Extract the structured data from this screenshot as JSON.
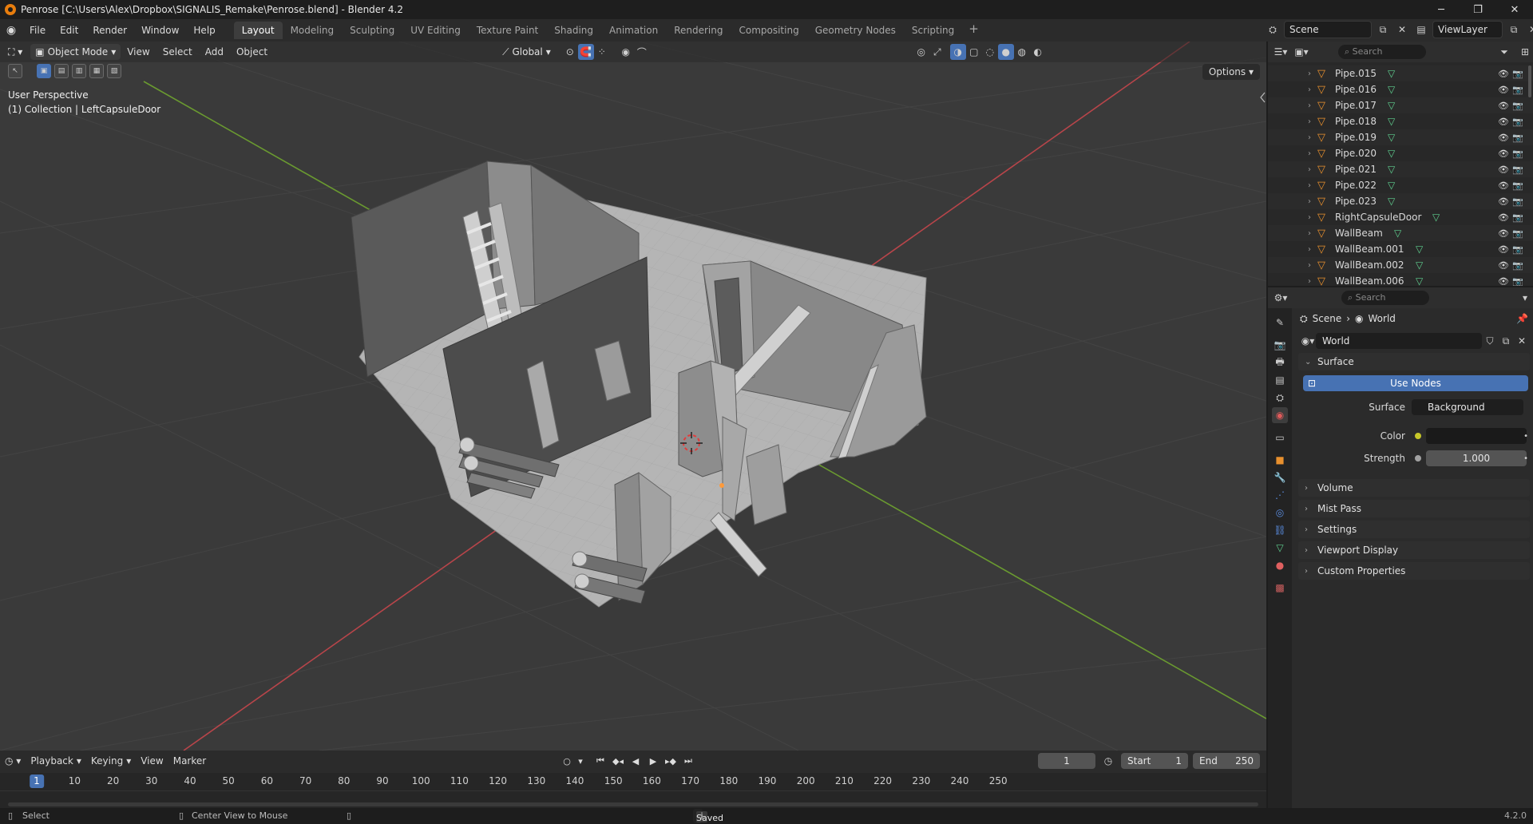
{
  "window": {
    "title": "Penrose [C:\\Users\\Alex\\Dropbox\\SIGNALIS_Remake\\Penrose.blend] - Blender 4.2",
    "controls": [
      "─",
      "❐",
      "✕"
    ]
  },
  "menubar": {
    "menus": [
      "File",
      "Edit",
      "Render",
      "Window",
      "Help"
    ],
    "workspaces": [
      "Layout",
      "Modeling",
      "Sculpting",
      "UV Editing",
      "Texture Paint",
      "Shading",
      "Animation",
      "Rendering",
      "Compositing",
      "Geometry Nodes",
      "Scripting"
    ],
    "active_workspace": "Layout",
    "scene": "Scene",
    "view_layer": "ViewLayer"
  },
  "viewport": {
    "mode": "Object Mode",
    "menus": [
      "View",
      "Select",
      "Add",
      "Object"
    ],
    "transform_orientation": "Global",
    "options_label": "Options",
    "perspective_label": "User Perspective",
    "collection_label": "(1) Collection | LeftCapsuleDoor"
  },
  "outliner": {
    "search_placeholder": "Search",
    "items": [
      {
        "name": "Pipe.015"
      },
      {
        "name": "Pipe.016"
      },
      {
        "name": "Pipe.017"
      },
      {
        "name": "Pipe.018"
      },
      {
        "name": "Pipe.019"
      },
      {
        "name": "Pipe.020"
      },
      {
        "name": "Pipe.021"
      },
      {
        "name": "Pipe.022"
      },
      {
        "name": "Pipe.023"
      },
      {
        "name": "RightCapsuleDoor"
      },
      {
        "name": "WallBeam"
      },
      {
        "name": "WallBeam.001"
      },
      {
        "name": "WallBeam.002"
      },
      {
        "name": "WallBeam.006"
      }
    ]
  },
  "properties": {
    "search_placeholder": "Search",
    "breadcrumb": [
      "Scene",
      "World"
    ],
    "world_name": "World",
    "surface_panel": "Surface",
    "use_nodes_label": "Use Nodes",
    "surface_label": "Surface",
    "surface_value": "Background",
    "color_label": "Color",
    "strength_label": "Strength",
    "strength_value": "1.000",
    "collapsed_panels": [
      "Volume",
      "Mist Pass",
      "Settings",
      "Viewport Display",
      "Custom Properties"
    ]
  },
  "timeline": {
    "menus": [
      "Playback",
      "Keying",
      "View",
      "Marker"
    ],
    "current_frame": "1",
    "start_label": "Start",
    "start_value": "1",
    "end_label": "End",
    "end_value": "250",
    "ticks": [
      "10",
      "20",
      "30",
      "40",
      "50",
      "60",
      "70",
      "80",
      "90",
      "100",
      "110",
      "120",
      "130",
      "140",
      "150",
      "160",
      "170",
      "180",
      "190",
      "200",
      "210",
      "220",
      "230",
      "240",
      "250"
    ]
  },
  "statusbar": {
    "select_label": "Select",
    "center_view_label": "Center View to Mouse",
    "message": "Saved \"Penrose.blend\"",
    "version": "4.2.0"
  },
  "colors": {
    "accent_blue": "#4772b3",
    "x_axis": "#b8454a",
    "y_axis": "#6a9a30",
    "mesh_orange": "#e8902e",
    "data_green": "#5fd08f"
  }
}
